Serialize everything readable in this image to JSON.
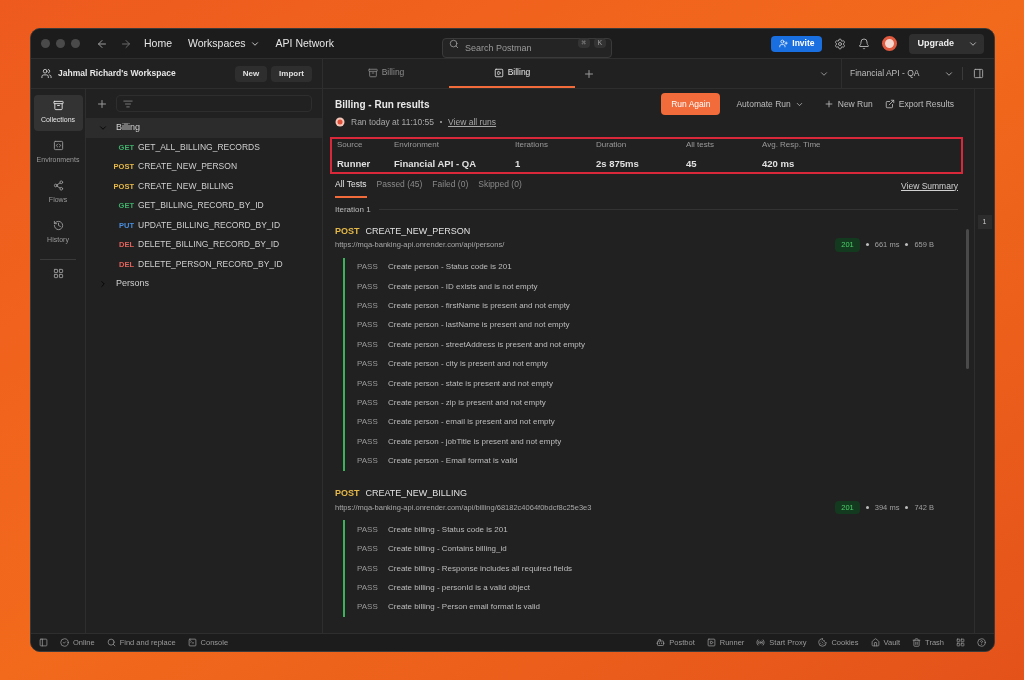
{
  "top_bar": {
    "nav": [
      {
        "label": "Home",
        "dropdown": false
      },
      {
        "label": "Workspaces",
        "dropdown": true
      },
      {
        "label": "API Network",
        "dropdown": false
      }
    ],
    "search": {
      "placeholder": "Search Postman",
      "shortcut": [
        "⌘",
        "K"
      ]
    },
    "invite": "Invite",
    "upgrade": "Upgrade"
  },
  "workspace": {
    "name": "Jahmal Richard's Workspace",
    "buttons": [
      "New",
      "Import"
    ]
  },
  "rail": [
    {
      "label": "Collections",
      "selected": true
    },
    {
      "label": "Environments",
      "selected": false
    },
    {
      "label": "Flows",
      "selected": false
    },
    {
      "label": "History",
      "selected": false
    }
  ],
  "tree": [
    {
      "label": "Billing",
      "expanded": true,
      "children": [
        {
          "method": "GET",
          "color": "#3fae6a",
          "name": "GET_ALL_BILLING_RECORDS"
        },
        {
          "method": "POST",
          "color": "#e5b84a",
          "name": "CREATE_NEW_PERSON"
        },
        {
          "method": "POST",
          "color": "#e5b84a",
          "name": "CREATE_NEW_BILLING"
        },
        {
          "method": "GET",
          "color": "#3fae6a",
          "name": "GET_BILLING_RECORD_BY_ID"
        },
        {
          "method": "PUT",
          "color": "#4a8fe0",
          "name": "UPDATE_BILLING_RECORD_BY_ID"
        },
        {
          "method": "DEL",
          "color": "#e0625a",
          "name": "DELETE_BILLING_RECORD_BY_ID"
        },
        {
          "method": "DEL",
          "color": "#e0625a",
          "name": "DELETE_PERSON_RECORD_BY_ID"
        }
      ]
    },
    {
      "label": "Persons",
      "expanded": false
    }
  ],
  "tabs": [
    {
      "label": "Billing",
      "kind": "collection",
      "selected": false
    },
    {
      "label": "Billing",
      "kind": "runner",
      "selected": true
    }
  ],
  "environment": "Financial API - QA",
  "run": {
    "title": "Billing - Run results",
    "ran": "Ran today at 11:10:55",
    "view_all": "View all runs",
    "actions": {
      "run_again": "Run Again",
      "automate": "Automate Run",
      "new_run": "New Run",
      "export": "Export Results"
    },
    "stats": [
      {
        "label": "Source",
        "value": "Runner"
      },
      {
        "label": "Environment",
        "value": "Financial API - QA"
      },
      {
        "label": "Iterations",
        "value": "1"
      },
      {
        "label": "Duration",
        "value": "2s 875ms"
      },
      {
        "label": "All tests",
        "value": "45"
      },
      {
        "label": "Avg. Resp. Time",
        "value": "420 ms"
      }
    ],
    "filters": [
      {
        "label": "All Tests",
        "selected": true
      },
      {
        "label": "Passed (45)",
        "selected": false
      },
      {
        "label": "Failed (0)",
        "selected": false
      },
      {
        "label": "Skipped (0)",
        "selected": false
      }
    ],
    "view_summary": "View Summary",
    "iteration": "Iteration 1",
    "iteration_badge": "1",
    "requests": [
      {
        "method": "POST",
        "name": "CREATE_NEW_PERSON",
        "url": "https://mqa-banking-api.onrender.com/api/persons/",
        "status": "201",
        "time": "661 ms",
        "size": "659 B",
        "tests": [
          {
            "result": "PASS",
            "name": "Create person - Status code is 201"
          },
          {
            "result": "PASS",
            "name": "Create person - ID exists and is not empty"
          },
          {
            "result": "PASS",
            "name": "Create person - firstName is present and not empty"
          },
          {
            "result": "PASS",
            "name": "Create person - lastName is present and not empty"
          },
          {
            "result": "PASS",
            "name": "Create person - streetAddress is present and not empty"
          },
          {
            "result": "PASS",
            "name": "Create person - city is present and not empty"
          },
          {
            "result": "PASS",
            "name": "Create person - state is present and not empty"
          },
          {
            "result": "PASS",
            "name": "Create person - zip is present and not empty"
          },
          {
            "result": "PASS",
            "name": "Create person - email is present and not empty"
          },
          {
            "result": "PASS",
            "name": "Create person - jobTitle is present and not empty"
          },
          {
            "result": "PASS",
            "name": "Create person - Email format is valid"
          }
        ]
      },
      {
        "method": "POST",
        "name": "CREATE_NEW_BILLING",
        "url": "https://mqa-banking-api.onrender.com/api/billing/68182c4064f0bdcf8c25e3e3",
        "status": "201",
        "time": "394 ms",
        "size": "742 B",
        "tests": [
          {
            "result": "PASS",
            "name": "Create billing - Status code is 201"
          },
          {
            "result": "PASS",
            "name": "Create billing - Contains billing_id"
          },
          {
            "result": "PASS",
            "name": "Create billing - Response includes all required fields"
          },
          {
            "result": "PASS",
            "name": "Create billing - personId is a valid object"
          },
          {
            "result": "PASS",
            "name": "Create billing - Person email format is valid"
          }
        ]
      }
    ]
  },
  "status_bar": {
    "left": [
      "Online",
      "Find and replace",
      "Console"
    ],
    "right": [
      "Postbot",
      "Runner",
      "Start Proxy",
      "Cookies",
      "Vault",
      "Trash"
    ]
  }
}
